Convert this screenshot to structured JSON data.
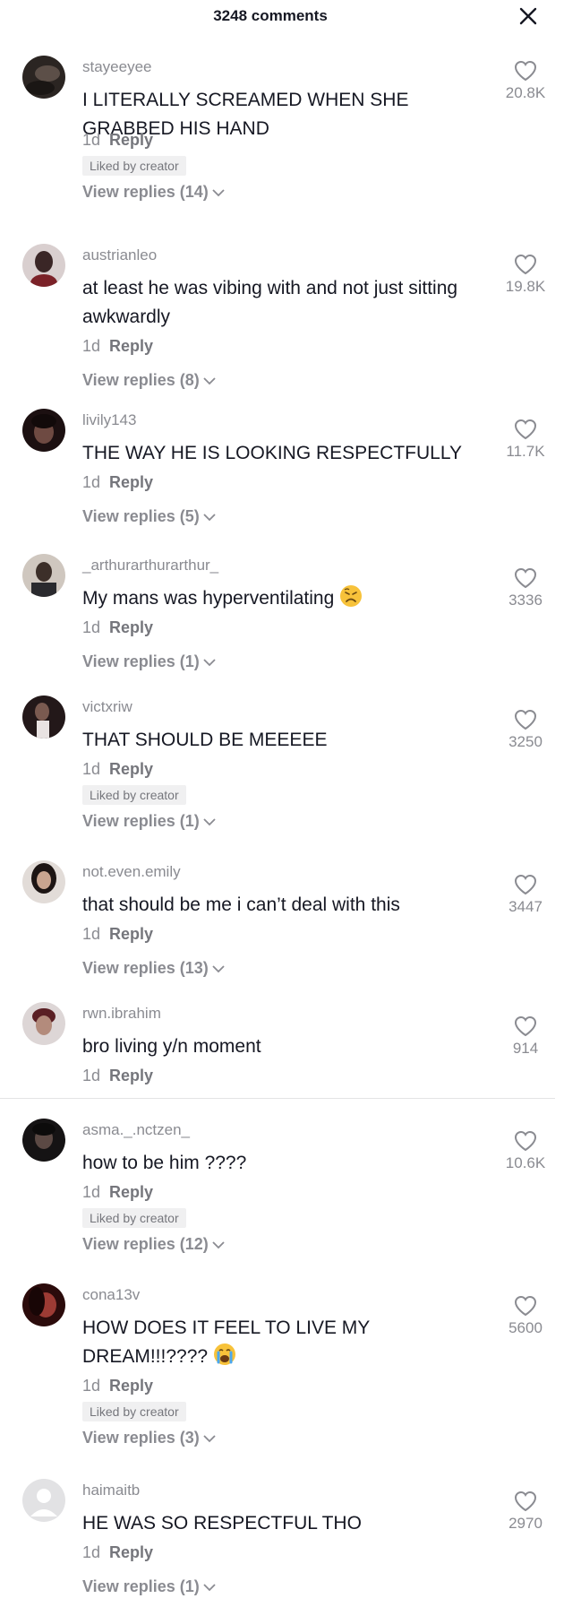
{
  "header": {
    "title": "3248 comments",
    "close_icon": "close-icon"
  },
  "labels": {
    "reply": "Reply",
    "liked_by_creator": "Liked by creator"
  },
  "colors": {
    "text": "#161823",
    "muted": "#8a8b91",
    "badge_bg": "#f0f0f1"
  },
  "comments": [
    {
      "username": "stayeeyee",
      "text": "I LITERALLY SCREAMED WHEN SHE GRABBED HIS HAND",
      "time": "1d",
      "likes": "20.8K",
      "liked_by_creator": true,
      "view_replies": "View replies (14)"
    },
    {
      "username": "austrianleo",
      "text": "at least he was vibing with and not just sitting awkwardly",
      "time": "1d",
      "likes": "19.8K",
      "liked_by_creator": false,
      "view_replies": "View replies (8)"
    },
    {
      "username": "livily143",
      "text": "THE WAY HE IS LOOKING RESPECTFULLY",
      "time": "1d",
      "likes": "11.7K",
      "liked_by_creator": false,
      "view_replies": "View replies (5)"
    },
    {
      "username": "_arthurarthurarthur_",
      "text": "My mans was hyperventilating",
      "emoji": "weary-face",
      "time": "1d",
      "likes": "3336",
      "liked_by_creator": false,
      "view_replies": "View replies (1)"
    },
    {
      "username": "victxriw",
      "text": "THAT SHOULD BE MEEEEE",
      "time": "1d",
      "likes": "3250",
      "liked_by_creator": true,
      "view_replies": "View replies (1)"
    },
    {
      "username": "not.even.emily",
      "text": "that should be me i can’t deal with this",
      "time": "1d",
      "likes": "3447",
      "liked_by_creator": false,
      "view_replies": "View replies (13)"
    },
    {
      "username": "rwn.ibrahim",
      "text": "bro living y/n moment",
      "time": "1d",
      "likes": "914",
      "liked_by_creator": false,
      "view_replies": ""
    },
    {
      "username": "asma._.nctzen_",
      "text": "how to be him ????",
      "time": "1d",
      "likes": "10.6K",
      "liked_by_creator": true,
      "view_replies": "View replies (12)"
    },
    {
      "username": "cona13v",
      "text": "HOW DOES IT FEEL TO LIVE MY DREAM!!!????",
      "emoji": "crying-face",
      "time": "1d",
      "likes": "5600",
      "liked_by_creator": true,
      "view_replies": "View replies (3)"
    },
    {
      "username": "haimaitb",
      "text": "HE WAS SO RESPECTFUL THO",
      "time": "1d",
      "likes": "2970",
      "liked_by_creator": false,
      "view_replies": "View replies (1)"
    }
  ]
}
